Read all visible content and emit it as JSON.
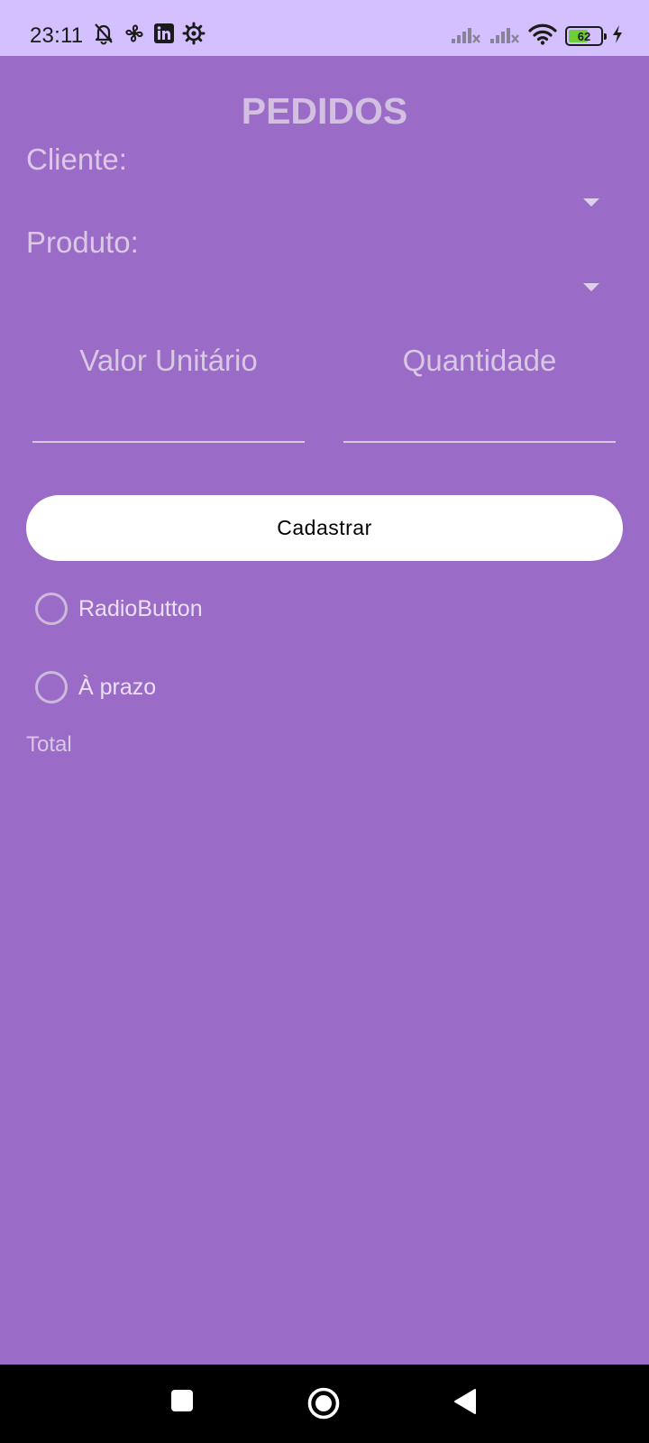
{
  "status_bar": {
    "time": "23:11",
    "battery_level": "62",
    "battery_fraction": 0.62,
    "left_icons": [
      "notifications-off-icon",
      "pinwheel-icon",
      "linkedin-icon",
      "settings-gear-icon"
    ],
    "right_icons": [
      "signal-off-icon",
      "signal-off-icon",
      "wifi-icon",
      "battery-icon",
      "charging-bolt-icon"
    ]
  },
  "form": {
    "title": "PEDIDOS",
    "cliente_label": "Cliente:",
    "produto_label": "Produto:",
    "valor_unitario_hint": "Valor Unitário",
    "quantidade_hint": "Quantidade",
    "cadastrar_label": "Cadastrar",
    "radio_options": [
      "RadioButton",
      "À prazo"
    ],
    "total_label": "Total"
  },
  "nav_bar": {
    "buttons": [
      "recents-square-icon",
      "home-circle-icon",
      "back-triangle-icon"
    ]
  },
  "colors": {
    "background": "#9a6cc8",
    "status_bar": "#d5c0ff",
    "button": "#ffffff"
  }
}
